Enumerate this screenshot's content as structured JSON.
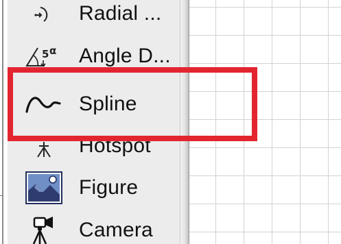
{
  "toolbox": {
    "items": [
      {
        "label": "Radial ...",
        "icon": "radial-dimension-icon"
      },
      {
        "label": "Angle D...",
        "icon": "angle-dimension-icon"
      },
      {
        "label": "Spline",
        "icon": "spline-icon"
      },
      {
        "label": "Hotspot",
        "icon": "hotspot-icon"
      },
      {
        "label": "Figure",
        "icon": "figure-icon"
      },
      {
        "label": "Camera",
        "icon": "camera-icon"
      }
    ]
  },
  "highlight": {
    "color": "#e32530",
    "target": "Spline"
  },
  "colors": {
    "panel": "#ececec",
    "canvas_grid": "#d2d2d2",
    "figure_sky": "#6f8fc6",
    "figure_mountain": "#2f3c70"
  }
}
